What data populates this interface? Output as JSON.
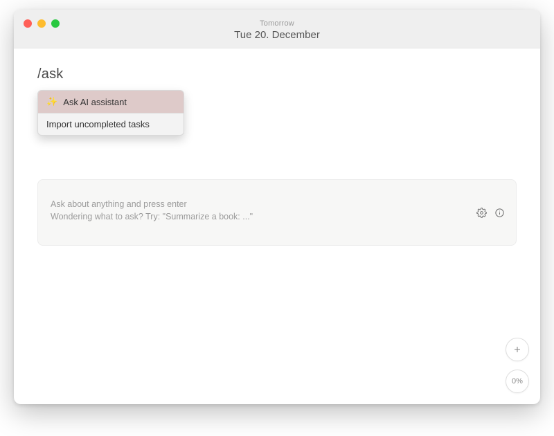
{
  "titlebar": {
    "super": "Tomorrow",
    "main": "Tue 20. December"
  },
  "command": {
    "text": "/ask"
  },
  "dropdown": {
    "items": [
      {
        "icon": "✨",
        "label": "Ask AI assistant",
        "selected": true
      },
      {
        "icon": "",
        "label": "Import uncompleted tasks",
        "selected": false
      }
    ]
  },
  "ask_panel": {
    "placeholder": "Ask about anything and press enter\nWondering what to ask? Try: \"Summarize a book: ...\""
  },
  "fab": {
    "plus": "+",
    "progress": "0%"
  },
  "icons": {
    "gear": "gear-icon",
    "info": "info-icon",
    "plus": "plus-icon"
  }
}
